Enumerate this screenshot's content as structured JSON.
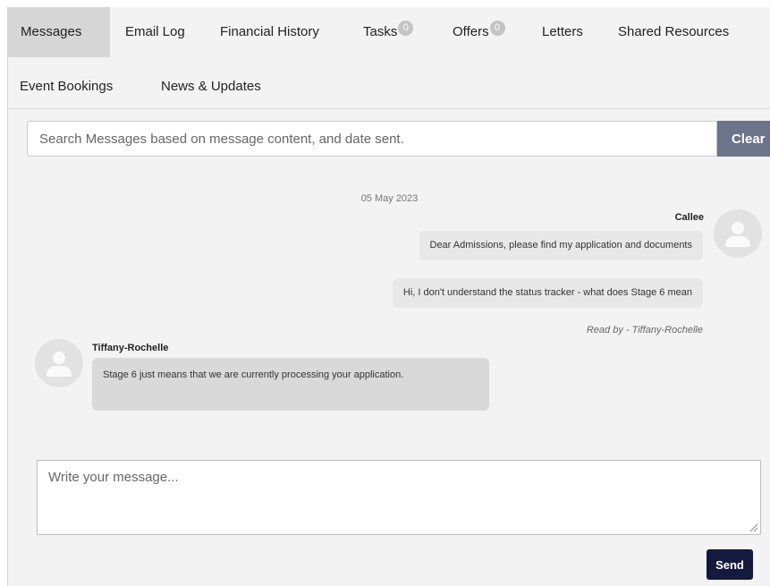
{
  "tabs": [
    {
      "label": "Messages",
      "active": true
    },
    {
      "label": "Email Log"
    },
    {
      "label": "Financial History"
    },
    {
      "label": "Tasks",
      "badge": "0"
    },
    {
      "label": "Offers",
      "badge": "0"
    },
    {
      "label": "Letters"
    },
    {
      "label": "Shared Resources"
    },
    {
      "label": "Event Bookings"
    },
    {
      "label": "News & Updates"
    }
  ],
  "search": {
    "placeholder": "Search Messages based on message content, and date sent.",
    "clear_label": "Clear"
  },
  "conversation": {
    "date": "05 May 2023",
    "outgoing": {
      "sender": "Callee",
      "messages": [
        "Dear Admissions, please find my application and documents",
        "Hi, I don't understand the status tracker - what does Stage 6 mean"
      ],
      "read_receipt": "Read by - Tiffany-Rochelle"
    },
    "incoming": {
      "sender": "Tiffany-Rochelle",
      "message": "Stage 6 just means that we are currently processing your application."
    }
  },
  "composer": {
    "placeholder": "Write your message...",
    "send_label": "Send"
  },
  "colors": {
    "active_tab": "#d6d6d6",
    "clear_button": "#6b7488",
    "send_button": "#141a3d",
    "badge": "#c4c4c4"
  }
}
